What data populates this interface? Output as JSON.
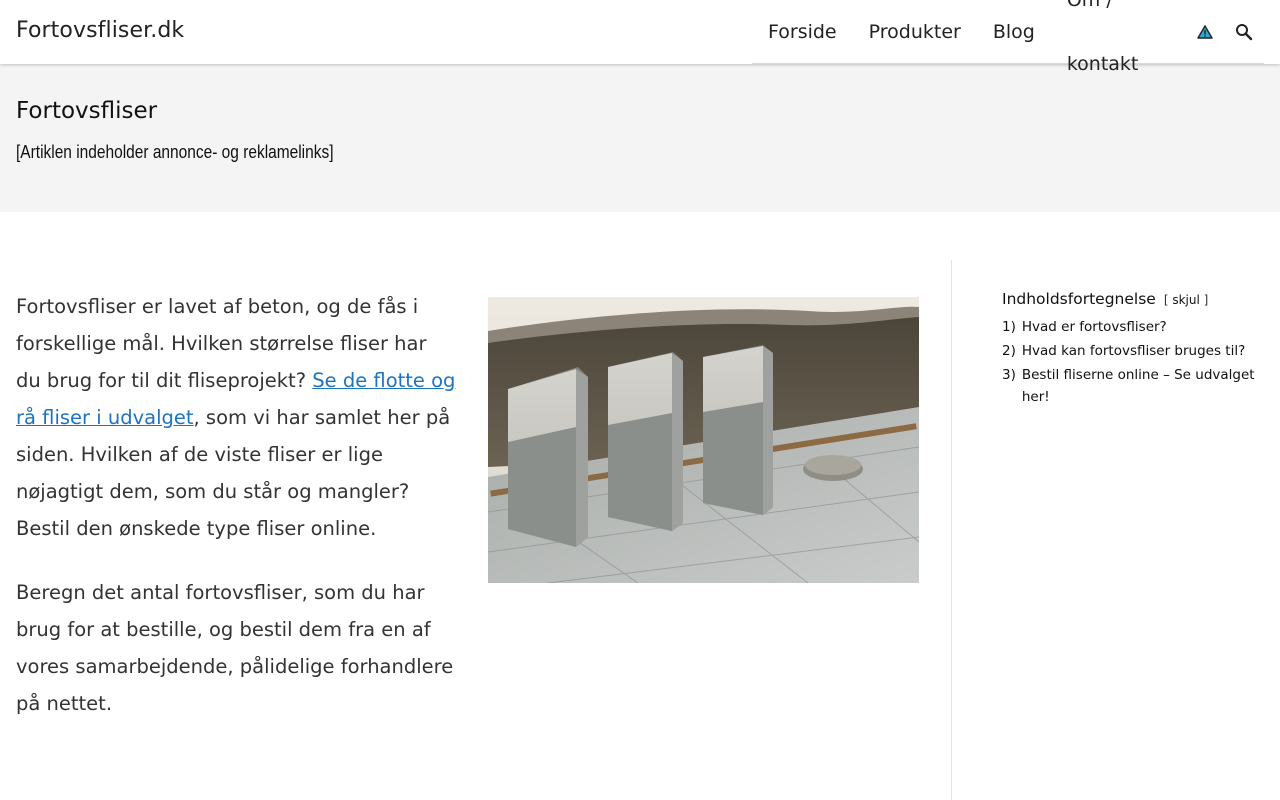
{
  "site": {
    "title": "Fortovsfliser.dk"
  },
  "nav": {
    "items": [
      {
        "label": "Forside"
      },
      {
        "label": "Produkter"
      },
      {
        "label": "Blog"
      },
      {
        "label": "Om / kontakt"
      }
    ],
    "icons": [
      "warning-icon",
      "search-icon"
    ]
  },
  "page": {
    "title": "Fortovsfliser",
    "note": "[Artiklen indeholder annonce- og reklamelinks]"
  },
  "content": {
    "p1_before": "Fortovsfliser er lavet af beton, og de fås i forskellige mål. Hvilken størrelse fliser har du brug for til dit fliseprojekt? ",
    "p1_link": "Se de flotte og rå fliser i udvalget",
    "p1_after": ", som vi har samlet her på siden. Hvilken af de viste fliser er lige nøjagtigt dem, som du står og mangler? Bestil den ønskede type fliser online.",
    "p2": "Beregn det antal fortovsfliser, som du har brug for at bestille, og bestil dem fra en af vores samarbejdende, pålidelige forhandlere på nettet."
  },
  "toc": {
    "title": "Indholdsfortegnelse",
    "toggle_open": "[",
    "toggle_label": "skjul",
    "toggle_close": "]",
    "items": [
      {
        "num": "1)",
        "label": "Hvad er fortovsfliser?"
      },
      {
        "num": "2)",
        "label": "Hvad kan fortovsfliser bruges til?"
      },
      {
        "num": "3)",
        "label": "Bestil fliserne online – Se udvalget her!"
      }
    ]
  },
  "colors": {
    "link": "#1e73be",
    "warning_icon": "#2aa8d4",
    "page_header_bg": "#f4f4f4"
  }
}
